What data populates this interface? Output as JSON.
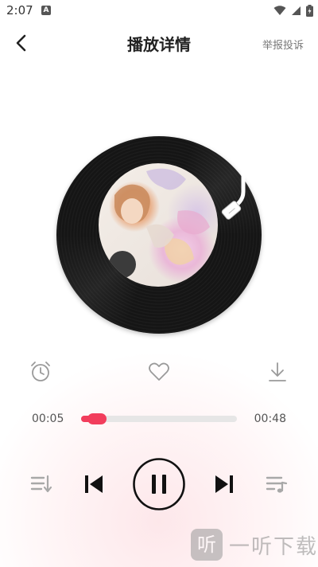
{
  "status_bar": {
    "time": "2:07",
    "notification_icon": "A"
  },
  "header": {
    "title": "播放详情",
    "report_label": "举报投诉"
  },
  "player": {
    "current_time": "00:05",
    "total_time": "00:48",
    "progress_fraction": 0.1,
    "accent_color": "#f23d5c"
  },
  "icons": {
    "back": "chevron-left-icon",
    "alarm": "alarm-clock-icon",
    "favorite": "heart-icon",
    "download": "download-icon",
    "playlist": "playlist-icon",
    "previous": "skip-previous-icon",
    "pause": "pause-icon",
    "next": "skip-next-icon",
    "play_mode": "music-list-icon"
  },
  "watermark": {
    "logo_char": "听",
    "text": "一听下载"
  }
}
